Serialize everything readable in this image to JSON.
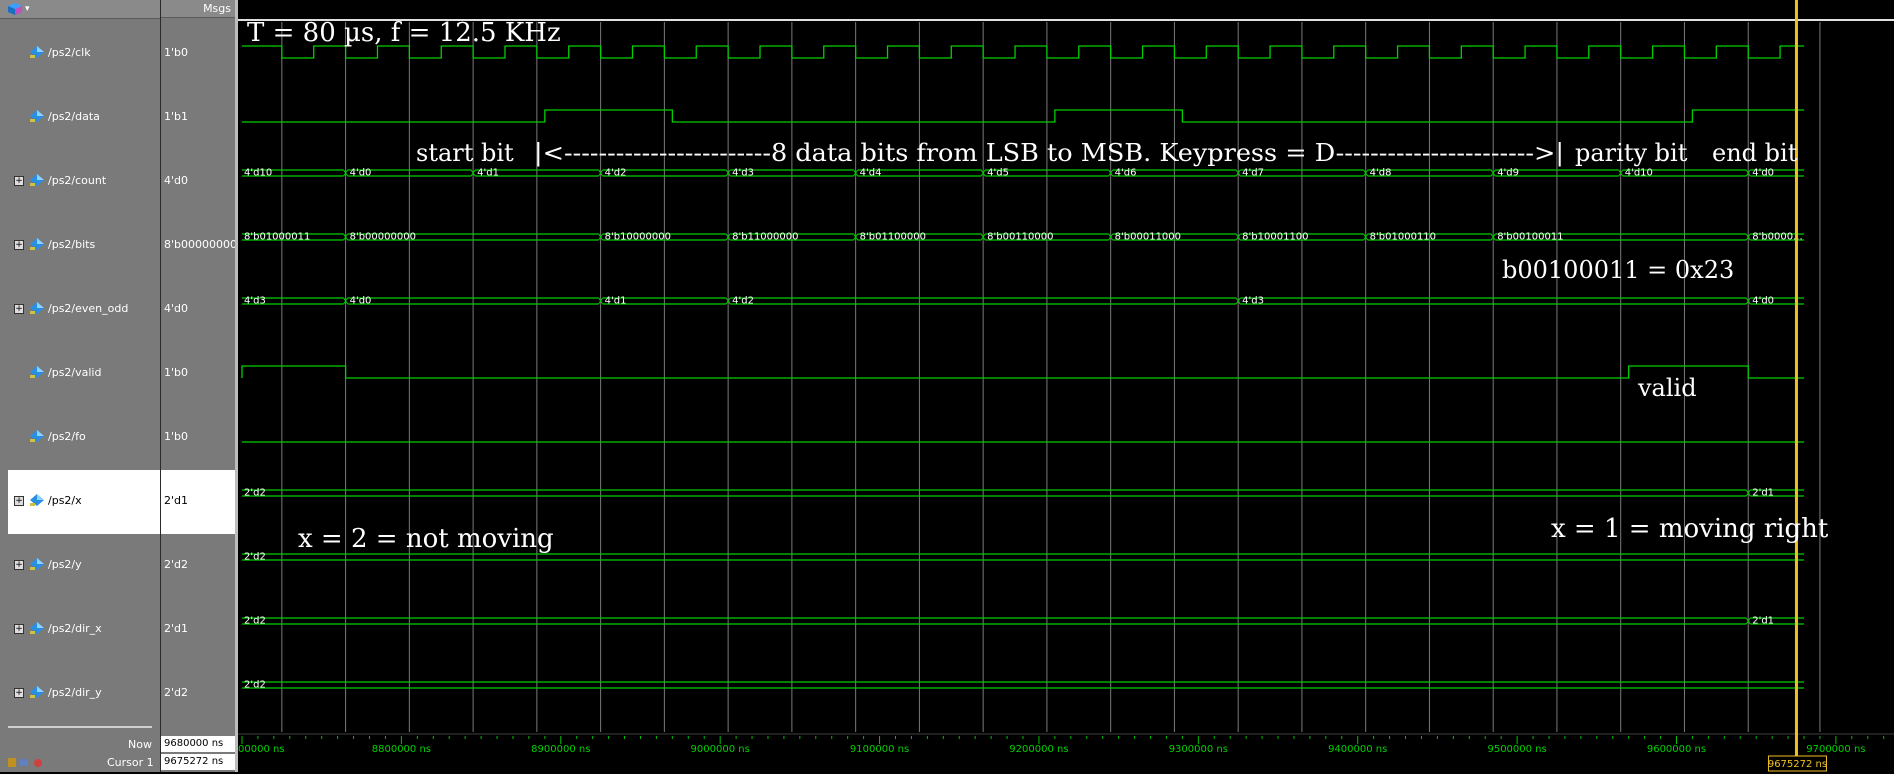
{
  "header": {
    "messages_label": "Msgs"
  },
  "signals": [
    {
      "name": "/ps2/clk",
      "value": "1'b0",
      "type": "bit",
      "expandable": false
    },
    {
      "name": "/ps2/data",
      "value": "1'b1",
      "type": "bit",
      "expandable": false
    },
    {
      "name": "/ps2/count",
      "value": "4'd0",
      "type": "bus",
      "expandable": true
    },
    {
      "name": "/ps2/bits",
      "value": "8'b00000000",
      "type": "bus",
      "expandable": true
    },
    {
      "name": "/ps2/even_odd",
      "value": "4'd0",
      "type": "bus",
      "expandable": true
    },
    {
      "name": "/ps2/valid",
      "value": "1'b0",
      "type": "bit",
      "expandable": false
    },
    {
      "name": "/ps2/fo",
      "value": "1'b0",
      "type": "bit",
      "expandable": false
    },
    {
      "name": "/ps2/x",
      "value": "2'd1",
      "type": "bus",
      "expandable": true,
      "selected": true
    },
    {
      "name": "/ps2/y",
      "value": "2'd2",
      "type": "bus",
      "expandable": true
    },
    {
      "name": "/ps2/dir_x",
      "value": "2'd1",
      "type": "bus",
      "expandable": true
    },
    {
      "name": "/ps2/dir_y",
      "value": "2'd2",
      "type": "bus",
      "expandable": true
    }
  ],
  "footer": {
    "now_label": "Now",
    "now_value": "9680000 ns",
    "cursor_label": "Cursor 1",
    "cursor_value": "9675272 ns",
    "cursor_marker": "9675272 ns"
  },
  "waves": {
    "t_start": 8700000,
    "t_end": 9680000,
    "cursor_time": 9675272,
    "count": [
      {
        "t": 8700000,
        "v": "4'd10"
      },
      {
        "t": 8765000,
        "v": "4'd0"
      },
      {
        "t": 8845000,
        "v": "4'd1"
      },
      {
        "t": 8925000,
        "v": "4'd2"
      },
      {
        "t": 9005000,
        "v": "4'd3"
      },
      {
        "t": 9085000,
        "v": "4'd4"
      },
      {
        "t": 9165000,
        "v": "4'd5"
      },
      {
        "t": 9245000,
        "v": "4'd6"
      },
      {
        "t": 9325000,
        "v": "4'd7"
      },
      {
        "t": 9405000,
        "v": "4'd8"
      },
      {
        "t": 9485000,
        "v": "4'd9"
      },
      {
        "t": 9565000,
        "v": "4'd10"
      },
      {
        "t": 9645000,
        "v": "4'd0"
      }
    ],
    "bits": [
      {
        "t": 8700000,
        "v": "8'b01000011"
      },
      {
        "t": 8765000,
        "v": "8'b00000000"
      },
      {
        "t": 8925000,
        "v": "8'b10000000"
      },
      {
        "t": 9005000,
        "v": "8'b11000000"
      },
      {
        "t": 9085000,
        "v": "8'b01100000"
      },
      {
        "t": 9165000,
        "v": "8'b00110000"
      },
      {
        "t": 9245000,
        "v": "8'b00011000"
      },
      {
        "t": 9325000,
        "v": "8'b10001100"
      },
      {
        "t": 9405000,
        "v": "8'b01000110"
      },
      {
        "t": 9485000,
        "v": "8'b00100011"
      },
      {
        "t": 9645000,
        "v": "8'b0000..."
      }
    ],
    "even_odd": [
      {
        "t": 8700000,
        "v": "4'd3"
      },
      {
        "t": 8765000,
        "v": "4'd0"
      },
      {
        "t": 8925000,
        "v": "4'd1"
      },
      {
        "t": 9005000,
        "v": "4'd2"
      },
      {
        "t": 9325000,
        "v": "4'd3"
      },
      {
        "t": 9645000,
        "v": "4'd0"
      }
    ],
    "x": [
      {
        "t": 8700000,
        "v": "2'd2"
      },
      {
        "t": 9645000,
        "v": "2'd1"
      }
    ],
    "y": [
      {
        "t": 8700000,
        "v": "2'd2"
      }
    ],
    "dir_x": [
      {
        "t": 8700000,
        "v": "2'd2"
      },
      {
        "t": 9645000,
        "v": "2'd1"
      }
    ],
    "dir_y": [
      {
        "t": 8700000,
        "v": "2'd2"
      }
    ],
    "clk_low_periods": [
      [
        8725000,
        8745000
      ],
      [
        8765000,
        8785000
      ],
      [
        8805000,
        8825000
      ],
      [
        8845000,
        8865000
      ],
      [
        8885000,
        8905000
      ],
      [
        8925000,
        8945000
      ],
      [
        8965000,
        8985000
      ],
      [
        9005000,
        9025000
      ],
      [
        9045000,
        9065000
      ],
      [
        9085000,
        9105000
      ],
      [
        9125000,
        9145000
      ],
      [
        9165000,
        9185000
      ],
      [
        9205000,
        9225000
      ],
      [
        9245000,
        9265000
      ],
      [
        9285000,
        9305000
      ],
      [
        9325000,
        9345000
      ],
      [
        9365000,
        9385000
      ],
      [
        9405000,
        9425000
      ],
      [
        9445000,
        9465000
      ],
      [
        9485000,
        9505000
      ],
      [
        9525000,
        9545000
      ],
      [
        9565000,
        9585000
      ],
      [
        9605000,
        9625000
      ],
      [
        9645000,
        9665000
      ]
    ],
    "data_high_periods": [
      [
        8890000,
        8970000
      ],
      [
        9210000,
        9290000
      ],
      [
        9610000,
        9680000
      ]
    ],
    "valid_high_periods": [
      [
        8700000,
        8765000
      ],
      [
        9570000,
        9645000
      ]
    ]
  },
  "time_axis": {
    "labels": [
      {
        "t": 8700000,
        "text": "00000 ns"
      },
      {
        "t": 8800000,
        "text": "8800000 ns"
      },
      {
        "t": 8900000,
        "text": "8900000 ns"
      },
      {
        "t": 9000000,
        "text": "9000000 ns"
      },
      {
        "t": 9100000,
        "text": "9100000 ns"
      },
      {
        "t": 9200000,
        "text": "9200000 ns"
      },
      {
        "t": 9300000,
        "text": "9300000 ns"
      },
      {
        "t": 9400000,
        "text": "9400000 ns"
      },
      {
        "t": 9500000,
        "text": "9500000 ns"
      },
      {
        "t": 9600000,
        "text": "9600000 ns"
      },
      {
        "t": 9700000,
        "text": "9700000 ns"
      }
    ]
  },
  "annotations": {
    "period": "T = 80 µs, f = 12.5 KHz",
    "start_bit": "start bit",
    "data_bits": "|<------------------------8 data bits from LSB to MSB. Keypress = D----------------------->|",
    "parity_bit": "parity bit",
    "end_bit": "end bit",
    "bits_value": "b00100011 = 0x23",
    "valid": "valid",
    "x_not_moving": "x = 2 = not moving",
    "x_moving_right": "x = 1 = moving right"
  },
  "colors": {
    "wave": "#00d000",
    "grid": "#7a7a7a",
    "cursor": "#f0c020",
    "panel": "#7a7a7a",
    "background": "#000000"
  }
}
